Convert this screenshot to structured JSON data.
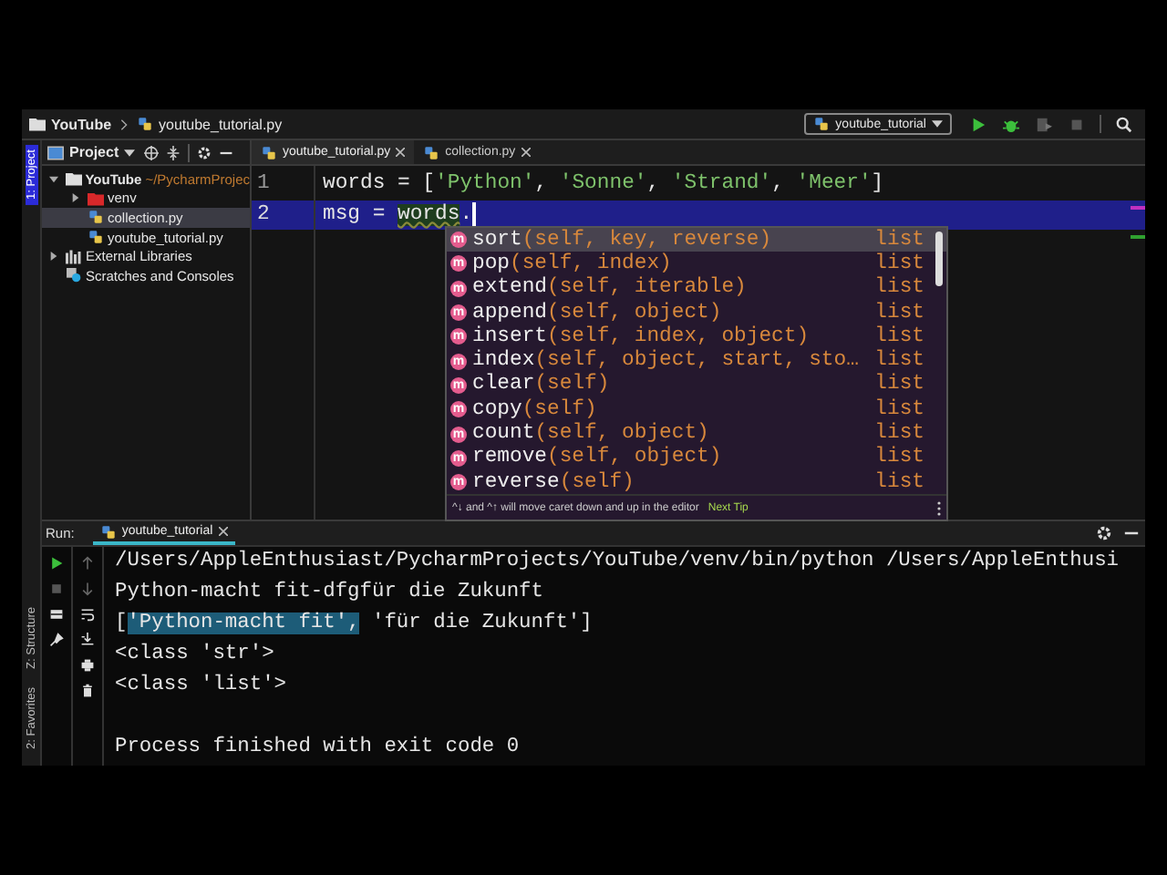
{
  "navbar": {
    "breadcrumbs": [
      "YouTube",
      "youtube_tutorial.py"
    ],
    "run_config": "youtube_tutorial"
  },
  "tool_stripe": {
    "top": [
      {
        "label": "1: Project",
        "selected": true
      }
    ],
    "bottom": [
      {
        "label": "Z: Structure",
        "selected": false
      },
      {
        "label": "2: Favorites",
        "selected": false
      }
    ]
  },
  "project": {
    "title": "Project",
    "tree": [
      {
        "name": "YouTube",
        "path": "~/PycharmProjec",
        "kind": "folder",
        "expanded": true,
        "selected": false,
        "children": [
          {
            "name": "venv",
            "kind": "excluded-folder",
            "expanded": false,
            "selected": false
          },
          {
            "name": "collection.py",
            "kind": "python",
            "selected": true
          },
          {
            "name": "youtube_tutorial.py",
            "kind": "python",
            "selected": false
          }
        ]
      },
      {
        "name": "External Libraries",
        "kind": "library",
        "expanded": false,
        "selected": false
      },
      {
        "name": "Scratches and Consoles",
        "kind": "scratch",
        "selected": false
      }
    ]
  },
  "editor": {
    "tabs": [
      {
        "label": "youtube_tutorial.py",
        "selected": true
      },
      {
        "label": "collection.py",
        "selected": false
      }
    ],
    "lines": [
      {
        "number": "1",
        "current": false,
        "tokens": [
          {
            "t": "words = [",
            "kind": "plain"
          },
          {
            "t": "'Python'",
            "kind": "string"
          },
          {
            "t": ", ",
            "kind": "plain"
          },
          {
            "t": "'Sonne'",
            "kind": "string"
          },
          {
            "t": ", ",
            "kind": "plain"
          },
          {
            "t": "'Strand'",
            "kind": "string"
          },
          {
            "t": ", ",
            "kind": "plain"
          },
          {
            "t": "'Meer'",
            "kind": "string"
          },
          {
            "t": "]",
            "kind": "plain"
          }
        ]
      },
      {
        "number": "2",
        "current": true,
        "tokens": [
          {
            "t": "msg = ",
            "kind": "plain"
          },
          {
            "t": "words",
            "kind": "warning"
          },
          {
            "t": ".",
            "kind": "plain"
          }
        ]
      }
    ]
  },
  "completion": {
    "items": [
      {
        "badge": "m",
        "name": "sort",
        "params": "(self, key, reverse)",
        "type": "list",
        "selected": true
      },
      {
        "badge": "m",
        "name": "pop",
        "params": "(self, index)",
        "type": "list",
        "selected": false
      },
      {
        "badge": "m",
        "name": "extend",
        "params": "(self, iterable)",
        "type": "list",
        "selected": false
      },
      {
        "badge": "m",
        "name": "append",
        "params": "(self, object)",
        "type": "list",
        "selected": false
      },
      {
        "badge": "m",
        "name": "insert",
        "params": "(self, index, object)",
        "type": "list",
        "selected": false
      },
      {
        "badge": "m",
        "name": "index",
        "params": "(self, object, start, sto…",
        "type": "list",
        "selected": false
      },
      {
        "badge": "m",
        "name": "clear",
        "params": "(self)",
        "type": "list",
        "selected": false
      },
      {
        "badge": "m",
        "name": "copy",
        "params": "(self)",
        "type": "list",
        "selected": false
      },
      {
        "badge": "m",
        "name": "count",
        "params": "(self, object)",
        "type": "list",
        "selected": false
      },
      {
        "badge": "m",
        "name": "remove",
        "params": "(self, object)",
        "type": "list",
        "selected": false
      },
      {
        "badge": "m",
        "name": "reverse",
        "params": "(self)",
        "type": "list",
        "selected": false
      }
    ],
    "hint": "^↓ and ^↑ will move caret down and up in the editor",
    "hint_link": "Next Tip"
  },
  "run": {
    "label": "Run:",
    "tab": "youtube_tutorial",
    "output": [
      {
        "kind": "line",
        "text": "/Users/AppleEnthusiast/PycharmProjects/YouTube/venv/bin/python /Users/AppleEnthusi"
      },
      {
        "kind": "line",
        "text": "Python-macht fit-dfgfür die Zukunft"
      },
      {
        "kind": "selection",
        "before": "[",
        "selected": "'Python-macht fit',",
        "after": " 'für die Zukunft']"
      },
      {
        "kind": "line",
        "text": "<class 'str'>"
      },
      {
        "kind": "line",
        "text": "<class 'list'>"
      },
      {
        "kind": "status",
        "text": "Process finished with exit code 0"
      }
    ]
  }
}
